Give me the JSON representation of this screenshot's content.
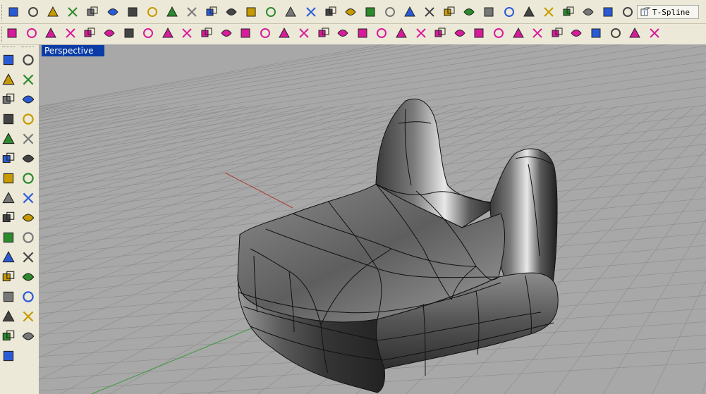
{
  "top_toolbar": {
    "icons": [
      "new-file-icon",
      "open-folder-icon",
      "save-icon",
      "print-icon",
      "save-template-icon",
      "cut-icon",
      "copy-icon",
      "paste-icon",
      "undo-icon",
      "pan-hand-icon",
      "rotate-view-icon",
      "zoom-icon",
      "zoom-window-icon",
      "zoom-extents-icon",
      "zoom-selected-icon",
      "undo-view-icon",
      "four-viewports-icon",
      "car-view-icon",
      "plane-grid-icon",
      "object-snap-icon",
      "select-points-icon",
      "lightbulb-icon",
      "lock-icon",
      "layer-icon",
      "color-wheel-icon",
      "sphere-wire-icon",
      "sphere-grid-icon",
      "shaded-sphere-icon",
      "render-cone-icon",
      "settings-gear-icon",
      "dimension-icon",
      "help-icon"
    ],
    "tspline_label": "T-Spline"
  },
  "second_toolbar": {
    "icons": [
      "tspline-box-icon",
      "tspline-cylinder-icon",
      "tspline-cube-icon",
      "pink-arrows-icon",
      "pink-wrench-icon",
      "pink-cube-icon",
      "point-grid-icon",
      "pink-link-icon",
      "pink-face-icon",
      "pink-pipe-icon",
      "pink-arch-icon",
      "pink-plane-icon",
      "pink-cube-edit-icon",
      "pink-cube-split-icon",
      "pink-ladder-icon",
      "pink-check-icon",
      "pink-mesh-icon",
      "pink-cross-icon",
      "pink-grid-icon",
      "pink-stack-icon",
      "pink-column-icon",
      "pink-square-icon",
      "pink-cube-small-icon",
      "pink-flow-icon",
      "pink-star-icon",
      "pink-ribbon-icon",
      "pink-steps-icon",
      "pink-wave-icon",
      "pink-extrude-icon",
      "pink-x-icon",
      "cube-dark-icon",
      "snap-points-icon",
      "pink-tree-icon",
      "pink-gear-icon"
    ]
  },
  "left_toolbar": {
    "icons": [
      "select-arrow-icon",
      "point-icon",
      "polyline-icon",
      "curve-points-icon",
      "circle-icon",
      "ellipse-icon",
      "arc-icon",
      "rectangle-icon",
      "polygon-icon",
      "curve-bend-icon",
      "surface-icon",
      "surface-fillet-icon",
      "surface-points-icon",
      "sphere-icon",
      "box-solid-icon",
      "plane-surface-icon",
      "cylinder-icon",
      "boolean-icon",
      "gear-icon",
      "dimension-line-icon",
      "transform-icon",
      "array-icon",
      "group-icon",
      "fillet-curve-icon",
      "trim-icon",
      "split-icon",
      "text-icon",
      "edit-point-icon",
      "array-grid-icon",
      "blocks-icon",
      "block-icon"
    ]
  },
  "viewport": {
    "label": "Perspective",
    "colors": {
      "background": "#a8a8a8",
      "grid": "#8f8f8f",
      "x_axis": "#b23a3a",
      "y_axis": "#3f9b3f"
    }
  }
}
